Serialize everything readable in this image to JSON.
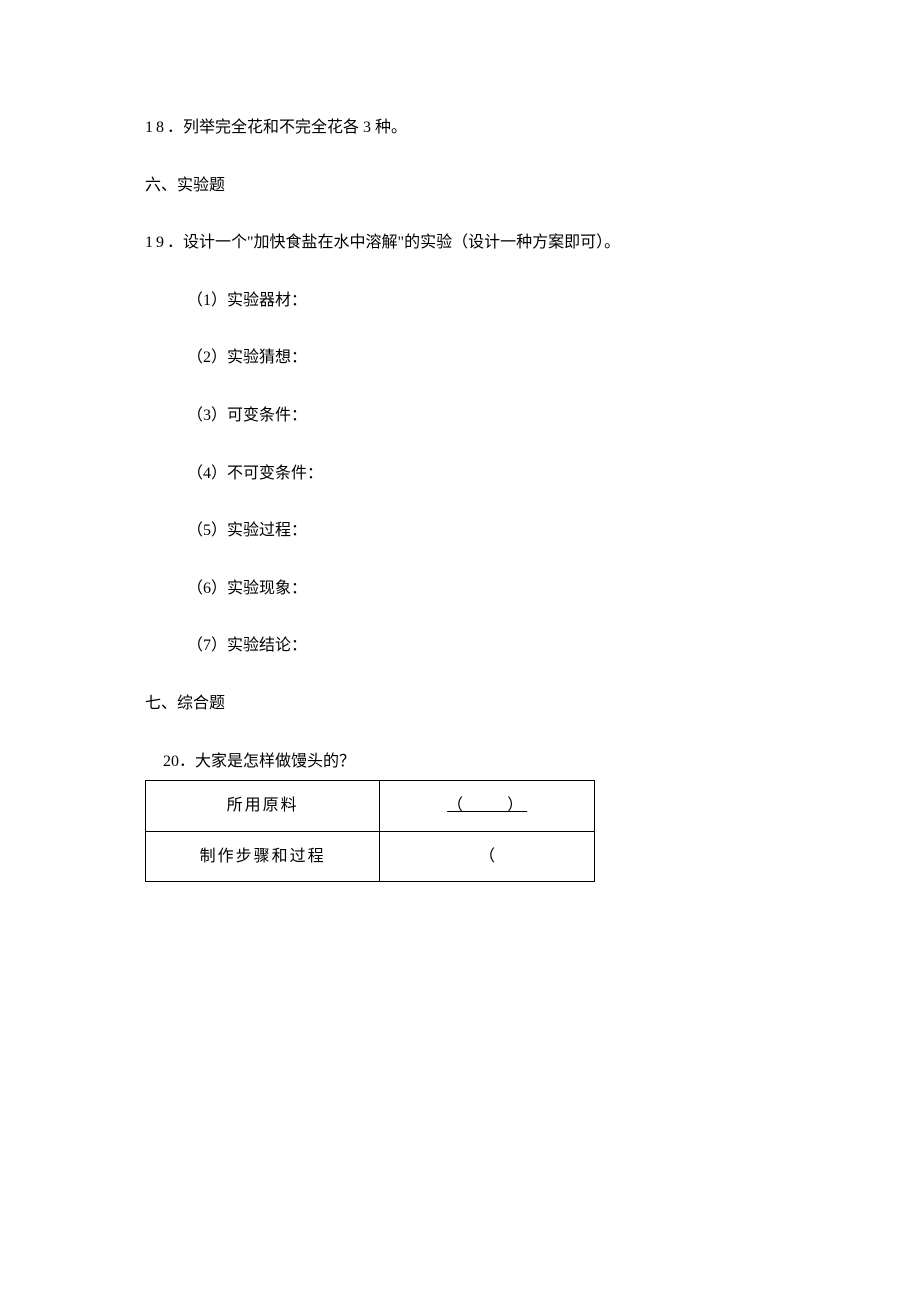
{
  "q18": {
    "num": "18",
    "text": "．列举完全花和不完全花各 3 种。"
  },
  "section6": "六、实验题",
  "q19": {
    "num": "19",
    "text": "．设计一个\"加快食盐在水中溶解\"的实验（设计一种方案即可）。",
    "items": [
      "（1）实验器材：",
      "（2）实验猜想：",
      "（3）可变条件：",
      "（4）不可变条件：",
      "（5）实验过程：",
      "（6）实验现象：",
      "（7）实验结论："
    ]
  },
  "section7": "七、综合题",
  "q20": {
    "title": "20．大家是怎样做馒头的？",
    "rows": [
      {
        "label": "所用原料",
        "blank": "（  ）",
        "underline": true
      },
      {
        "label": "制作步骤和过程",
        "blank": "（",
        "underline": false
      }
    ]
  }
}
